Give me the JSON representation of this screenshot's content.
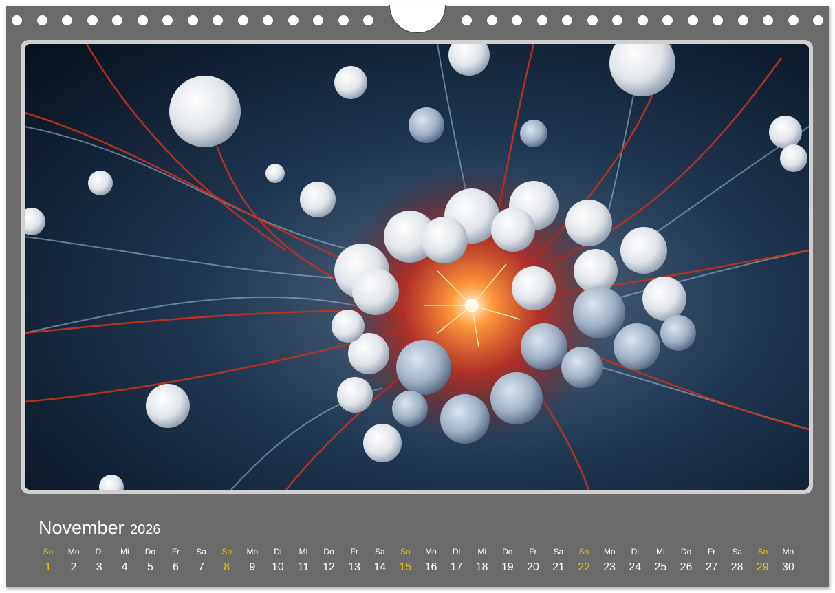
{
  "calendar": {
    "month": "November",
    "year": "2026",
    "days": [
      {
        "name": "So",
        "num": "1"
      },
      {
        "name": "Mo",
        "num": "2"
      },
      {
        "name": "Di",
        "num": "3"
      },
      {
        "name": "Mi",
        "num": "4"
      },
      {
        "name": "Do",
        "num": "5"
      },
      {
        "name": "Fr",
        "num": "6"
      },
      {
        "name": "Sa",
        "num": "7"
      },
      {
        "name": "So",
        "num": "8"
      },
      {
        "name": "Mo",
        "num": "9"
      },
      {
        "name": "Di",
        "num": "10"
      },
      {
        "name": "Mi",
        "num": "11"
      },
      {
        "name": "Do",
        "num": "12"
      },
      {
        "name": "Fr",
        "num": "13"
      },
      {
        "name": "Sa",
        "num": "14"
      },
      {
        "name": "So",
        "num": "15"
      },
      {
        "name": "Mo",
        "num": "16"
      },
      {
        "name": "Di",
        "num": "17"
      },
      {
        "name": "Mi",
        "num": "18"
      },
      {
        "name": "Do",
        "num": "19"
      },
      {
        "name": "Fr",
        "num": "20"
      },
      {
        "name": "Sa",
        "num": "21"
      },
      {
        "name": "So",
        "num": "22"
      },
      {
        "name": "Mo",
        "num": "23"
      },
      {
        "name": "Di",
        "num": "24"
      },
      {
        "name": "Mi",
        "num": "25"
      },
      {
        "name": "Do",
        "num": "26"
      },
      {
        "name": "Fr",
        "num": "27"
      },
      {
        "name": "Sa",
        "num": "28"
      },
      {
        "name": "So",
        "num": "29"
      },
      {
        "name": "Mo",
        "num": "30"
      }
    ]
  },
  "colors": {
    "background": "#6b6b6b",
    "frame": "#d0d0d0",
    "text": "#ffffff",
    "sunday": "#f2c200"
  },
  "photo": {
    "subject": "neuron-cell-illustration"
  }
}
